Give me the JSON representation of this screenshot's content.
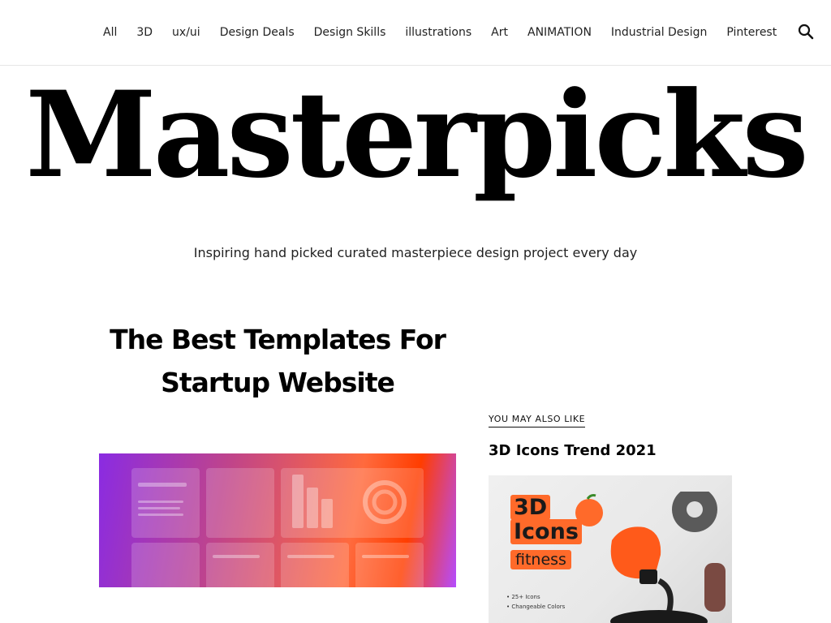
{
  "nav": {
    "items": [
      "All",
      "3D",
      "ux/ui",
      "Design Deals",
      "Design Skills",
      "illustrations",
      "Art",
      "ANIMATION",
      "Industrial Design",
      "Pinterest"
    ],
    "search_icon": "search-icon"
  },
  "brand": {
    "title": "Masterpicks",
    "tagline": "Inspiring hand picked curated masterpiece design project every day"
  },
  "post": {
    "title": "The Best Templates For Startup Website"
  },
  "sidebar": {
    "label": "YOU MAY ALSO LIKE",
    "title": "3D Icons Trend 2021",
    "image": {
      "line1": "3D",
      "line2": "Icons",
      "badge": "fitness",
      "bullet1": "• 25+ Icons",
      "bullet2": "• Changeable Colors"
    }
  },
  "colors": {
    "accent": "#ff6a2a",
    "text": "#111111"
  }
}
